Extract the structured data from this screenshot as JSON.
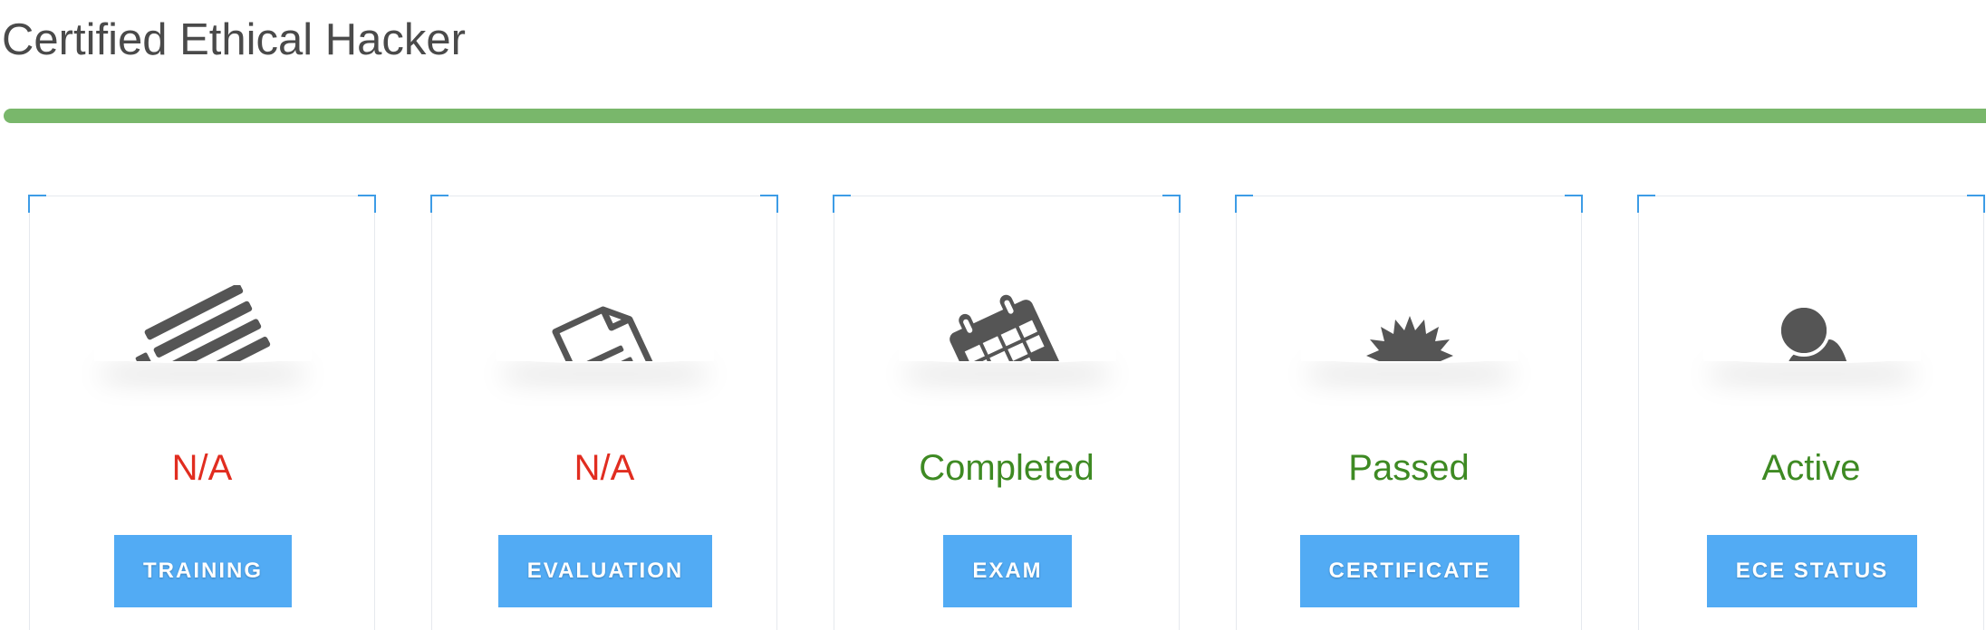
{
  "page": {
    "title": "Certified Ethical Hacker",
    "progress_percent": 100
  },
  "colors": {
    "progress": "#79b76b",
    "accent": "#52abf4",
    "status_bad": "#e12d20",
    "status_good": "#3e8a23"
  },
  "cards": [
    {
      "icon": "list-icon",
      "status": "N/A",
      "status_kind": "bad",
      "button_label": "TRAINING"
    },
    {
      "icon": "document-icon",
      "status": "N/A",
      "status_kind": "bad",
      "button_label": "EVALUATION"
    },
    {
      "icon": "calendar-icon",
      "status": "Completed",
      "status_kind": "good",
      "button_label": "EXAM"
    },
    {
      "icon": "badge-icon",
      "status": "Passed",
      "status_kind": "good",
      "button_label": "CERTIFICATE"
    },
    {
      "icon": "user-icon",
      "status": "Active",
      "status_kind": "good",
      "button_label": "ECE STATUS"
    }
  ]
}
